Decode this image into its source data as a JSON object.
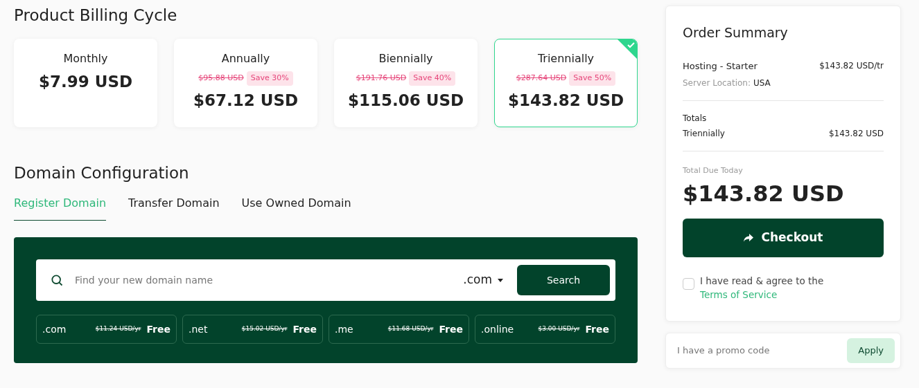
{
  "billing": {
    "title": "Product Billing Cycle",
    "cycles": [
      {
        "name": "Monthly",
        "price": "$7.99 USD",
        "selected": false
      },
      {
        "name": "Annually",
        "old_price": "$95.88 USD",
        "save": "Save 30%",
        "price": "$67.12 USD",
        "selected": false
      },
      {
        "name": "Biennially",
        "old_price": "$191.76 USD",
        "save": "Save 40%",
        "price": "$115.06 USD",
        "selected": false
      },
      {
        "name": "Triennially",
        "old_price": "$287.64 USD",
        "save": "Save 50%",
        "price": "$143.82 USD",
        "selected": true
      }
    ]
  },
  "domain": {
    "title": "Domain Configuration",
    "tabs": [
      {
        "label": "Register Domain",
        "selected": true
      },
      {
        "label": "Transfer Domain",
        "selected": false
      },
      {
        "label": "Use Owned Domain",
        "selected": false
      }
    ],
    "search": {
      "placeholder": "Find your new domain name",
      "tld": ".com",
      "button": "Search"
    },
    "suggestions": [
      {
        "tld": ".com",
        "old_price": "$11.24 USD/yr",
        "price": "Free"
      },
      {
        "tld": ".net",
        "old_price": "$15.02 USD/yr",
        "price": "Free"
      },
      {
        "tld": ".me",
        "old_price": "$11.68 USD/yr",
        "price": "Free"
      },
      {
        "tld": ".online",
        "old_price": "$3.00 USD/yr",
        "price": "Free"
      }
    ]
  },
  "summary": {
    "title": "Order Summary",
    "product": "Hosting - Starter",
    "product_price": "$143.82 USD/tr",
    "location_label": "Server Location:",
    "location": "USA",
    "totals_label": "Totals",
    "cycle": "Triennially",
    "cycle_price": "$143.82 USD",
    "due_label": "Total Due Today",
    "due": "$143.82 USD",
    "checkout": "Checkout",
    "terms_text": "I have read & agree to the",
    "terms_link": "Terms of Service",
    "terms_checked": false
  },
  "promo": {
    "placeholder": "I have a promo code",
    "button": "Apply"
  }
}
